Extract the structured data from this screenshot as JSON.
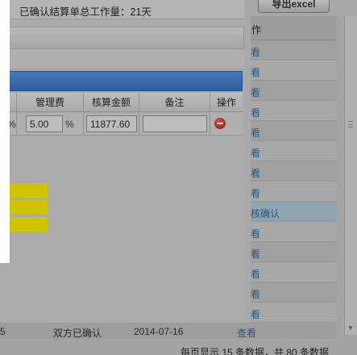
{
  "background": {
    "export_label": "导出excel",
    "header_fragment": "作",
    "row_links": [
      "看",
      "看",
      "看",
      "看",
      "看",
      "看",
      "看",
      "看",
      "核确认",
      "看",
      "看",
      "看",
      "看",
      "看"
    ],
    "bottom_row": {
      "col1": "5",
      "status": "双方已确认",
      "date": "2014-07-16",
      "link": "查看"
    },
    "footer": "每页显示 15 条数据，共 80 条数据"
  },
  "modal": {
    "summary": "已确认结算单总工作量：21天",
    "table": {
      "headers": [
        "管理费",
        "核算金额",
        "备注",
        "操作"
      ],
      "row": {
        "left_pct": "%",
        "fee": "5.00",
        "fee_pct": "%",
        "amount": "11877.60",
        "remark": ""
      }
    }
  },
  "colors": {
    "blue_bar": "#3a69a9",
    "yellow_block": "#d0c402",
    "delete_icon": "#b02020"
  }
}
